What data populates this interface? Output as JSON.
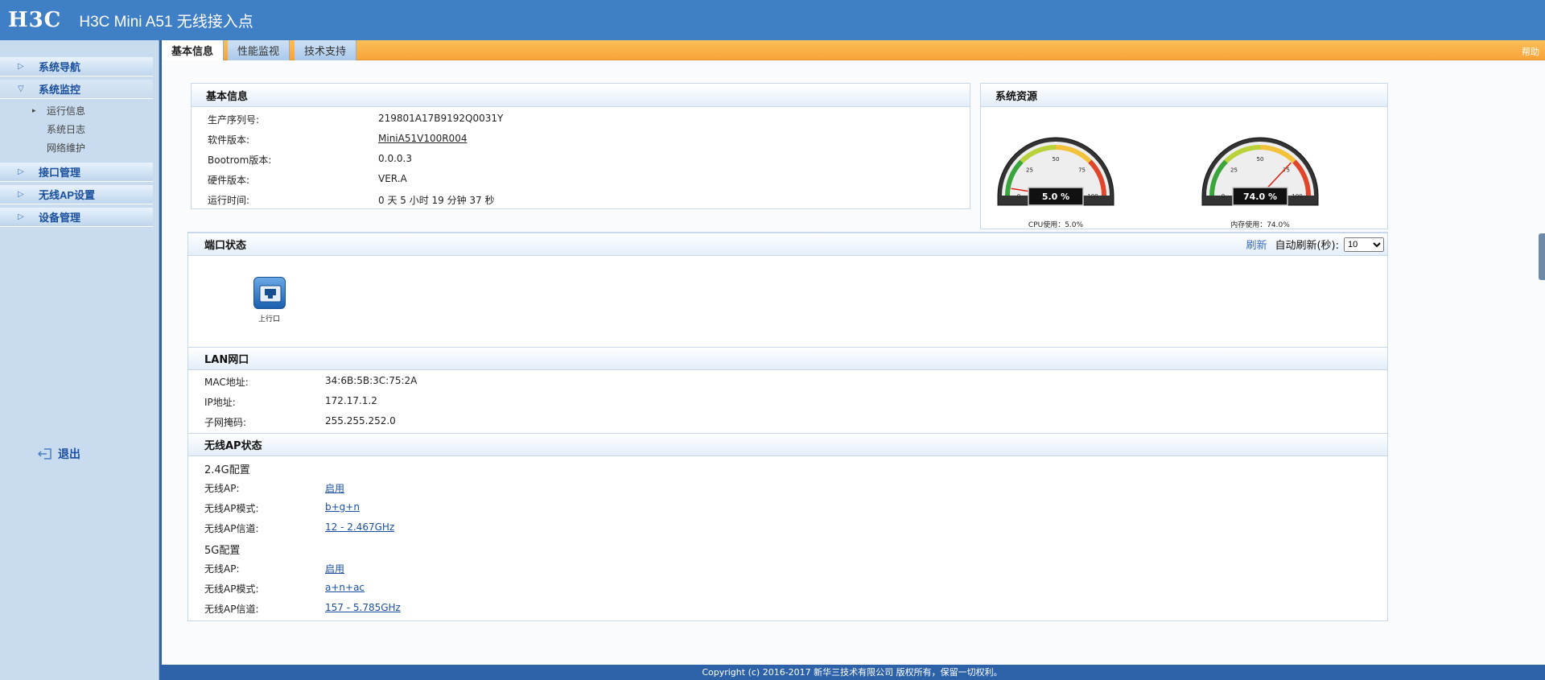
{
  "banner": {
    "logo": "H3C",
    "product": "H3C Mini A51 无线接入点"
  },
  "sidebar": {
    "items": [
      {
        "label": "系统导航"
      },
      {
        "label": "系统监控"
      },
      {
        "label": "接口管理"
      },
      {
        "label": "无线AP设置"
      },
      {
        "label": "设备管理"
      }
    ],
    "sub": [
      {
        "label": "运行信息"
      },
      {
        "label": "系统日志"
      },
      {
        "label": "网络维护"
      }
    ],
    "logout": "退出"
  },
  "tabs": [
    {
      "label": "基本信息"
    },
    {
      "label": "性能监视"
    },
    {
      "label": "技术支持"
    }
  ],
  "help": "帮助",
  "basic": {
    "title": "基本信息",
    "rows": [
      {
        "k": "生产序列号:",
        "v": "219801A17B9192Q0031Y"
      },
      {
        "k": "软件版本:",
        "v": "MiniA51V100R004"
      },
      {
        "k": "Bootrom版本:",
        "v": "0.0.0.3"
      },
      {
        "k": "硬件版本:",
        "v": "VER.A"
      },
      {
        "k": "运行时间:",
        "v": "0 天 5 小时 19 分钟 37 秒"
      }
    ]
  },
  "resources": {
    "title": "系统资源",
    "cpu": {
      "value": 5.0,
      "display": "5.0 %",
      "caption": "CPU使用：5.0%"
    },
    "mem": {
      "value": 74.0,
      "display": "74.0 %",
      "caption": "内存使用：74.0%"
    },
    "ticks": [
      "0",
      "25",
      "50",
      "75",
      "100"
    ]
  },
  "ports": {
    "title": "端口状态",
    "refresh": "刷新",
    "auto_refresh": "自动刷新(秒):",
    "interval": "10",
    "uplink": "上行口"
  },
  "lan": {
    "title": "LAN网口",
    "rows": [
      {
        "k": "MAC地址:",
        "v": "34:6B:5B:3C:75:2A"
      },
      {
        "k": "IP地址:",
        "v": "172.17.1.2"
      },
      {
        "k": "子网掩码:",
        "v": "255.255.252.0"
      }
    ]
  },
  "wlan": {
    "title": "无线AP状态",
    "g24": "2.4G配置",
    "g24_rows": [
      {
        "k": "无线AP:",
        "v": "启用"
      },
      {
        "k": "无线AP模式:",
        "v": "b+g+n"
      },
      {
        "k": "无线AP信道:",
        "v": "12 - 2.467GHz"
      }
    ],
    "g5": "5G配置",
    "g5_rows": [
      {
        "k": "无线AP:",
        "v": "启用"
      },
      {
        "k": "无线AP模式:",
        "v": "a+n+ac"
      },
      {
        "k": "无线AP信道:",
        "v": "157 - 5.785GHz"
      }
    ]
  },
  "footer": "Copyright (c) 2016-2017 新华三技术有限公司 版权所有，保留一切权利。"
}
